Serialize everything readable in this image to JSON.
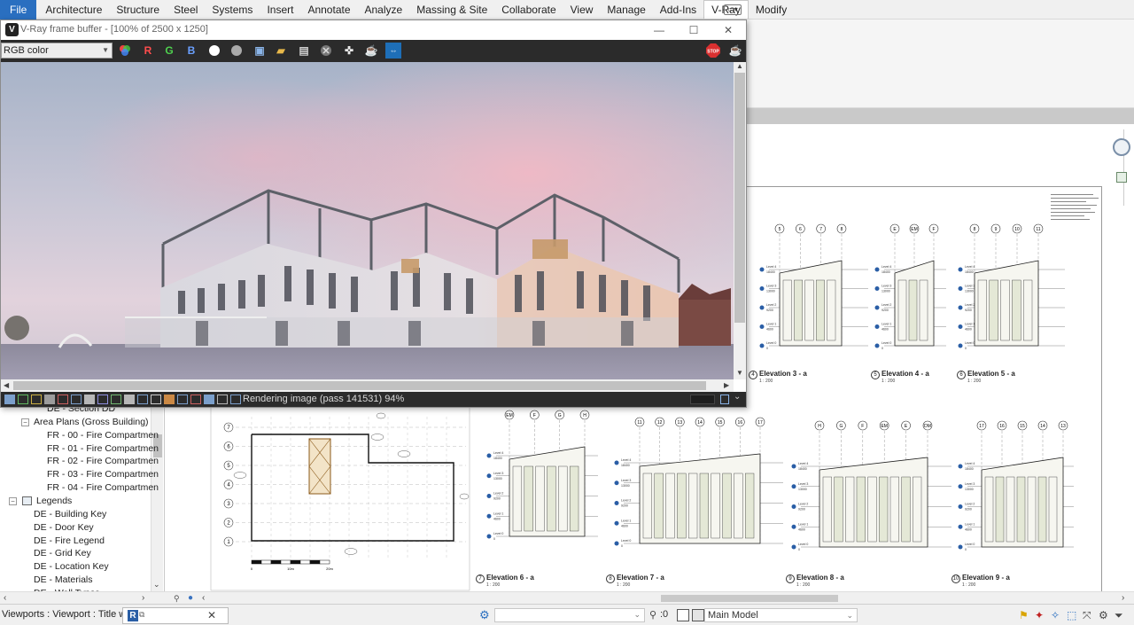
{
  "ribbon": {
    "tabs": [
      "File",
      "Architecture",
      "Structure",
      "Steel",
      "Systems",
      "Insert",
      "Annotate",
      "Analyze",
      "Massing & Site",
      "Collaborate",
      "View",
      "Manage",
      "Add-Ins",
      "V-Ray",
      "Modify"
    ],
    "active_tab": "V-Ray"
  },
  "vfb": {
    "title": "V-Ray frame buffer - [100% of 2500 x 1250]",
    "channel": "RGB color",
    "channel_buttons": [
      "R",
      "G",
      "B"
    ],
    "status_message": "Rendering image (pass 141531) 94%"
  },
  "browser": {
    "items": [
      {
        "label": "DE - Section DD",
        "indent": 3
      },
      {
        "label": "Area Plans (Gross Building)",
        "indent": 2,
        "toggle": "−"
      },
      {
        "label": "FR - 00 - Fire Compartmen",
        "indent": 3
      },
      {
        "label": "FR - 01 - Fire Compartmen",
        "indent": 3
      },
      {
        "label": "FR - 02 - Fire Compartmen",
        "indent": 3
      },
      {
        "label": "FR - 03 - Fire Compartmen",
        "indent": 3
      },
      {
        "label": "FR - 04 - Fire Compartmen",
        "indent": 3
      },
      {
        "label": "Legends",
        "indent": 1,
        "toggle": "−"
      },
      {
        "label": "DE - Building Key",
        "indent": 2
      },
      {
        "label": "DE - Door Key",
        "indent": 2
      },
      {
        "label": "DE - Fire Legend",
        "indent": 2
      },
      {
        "label": "DE - Grid Key",
        "indent": 2
      },
      {
        "label": "DE - Location Key",
        "indent": 2
      },
      {
        "label": "DE - Materials",
        "indent": 2
      },
      {
        "label": "DE - Wall Types",
        "indent": 2
      }
    ]
  },
  "elevations": [
    {
      "num": "4",
      "title": "Elevation 3 - a",
      "scale": "1 : 200",
      "grids": [
        "5",
        "6",
        "7",
        "8"
      ]
    },
    {
      "num": "5",
      "title": "Elevation 4 - a",
      "scale": "1 : 200",
      "grids": [
        "E",
        "EM",
        "F"
      ]
    },
    {
      "num": "6",
      "title": "Elevation 5 - a",
      "scale": "1 : 200",
      "grids": [
        "8",
        "9",
        "10",
        "11"
      ]
    },
    {
      "num": "7",
      "title": "Elevation 6 - a",
      "scale": "1 : 200",
      "grids": [
        "EM",
        "F",
        "G",
        "H"
      ]
    },
    {
      "num": "8",
      "title": "Elevation 7 - a",
      "scale": "1 : 200",
      "grids": [
        "11",
        "12",
        "13",
        "14",
        "15",
        "16",
        "17"
      ]
    },
    {
      "num": "9",
      "title": "Elevation 8 - a",
      "scale": "1 : 200",
      "grids": [
        "H",
        "G",
        "F",
        "EM",
        "E",
        "DM"
      ]
    },
    {
      "num": "10",
      "title": "Elevation 9 - a",
      "scale": "1 : 200",
      "grids": [
        "17",
        "16",
        "15",
        "14",
        "13"
      ]
    }
  ],
  "levels": [
    "Level 4",
    "Level 3",
    "Level 2",
    "Level 1",
    "Level 0"
  ],
  "level_values": [
    "18400",
    "13000",
    "9200",
    "4600",
    "0"
  ],
  "plan": {
    "grid_rows": [
      "7",
      "6",
      "5",
      "4",
      "3",
      "2",
      "1"
    ],
    "scale_labels": [
      "0",
      "10m",
      "20m"
    ]
  },
  "status": {
    "viewport_text": "Viewports : Viewport : Title w L",
    "model": "Main Model",
    "zoom_value": ":0",
    "revit_mark": "R"
  },
  "colors": {
    "file_tab": "#2a6fc0",
    "vfb_toolbar": "#2b2b2b",
    "stop_button": "#d93030"
  },
  "icons": [
    "stop-icon",
    "teapot-icon",
    "save-icon",
    "open-icon",
    "close-icon",
    "crosshair-icon"
  ]
}
